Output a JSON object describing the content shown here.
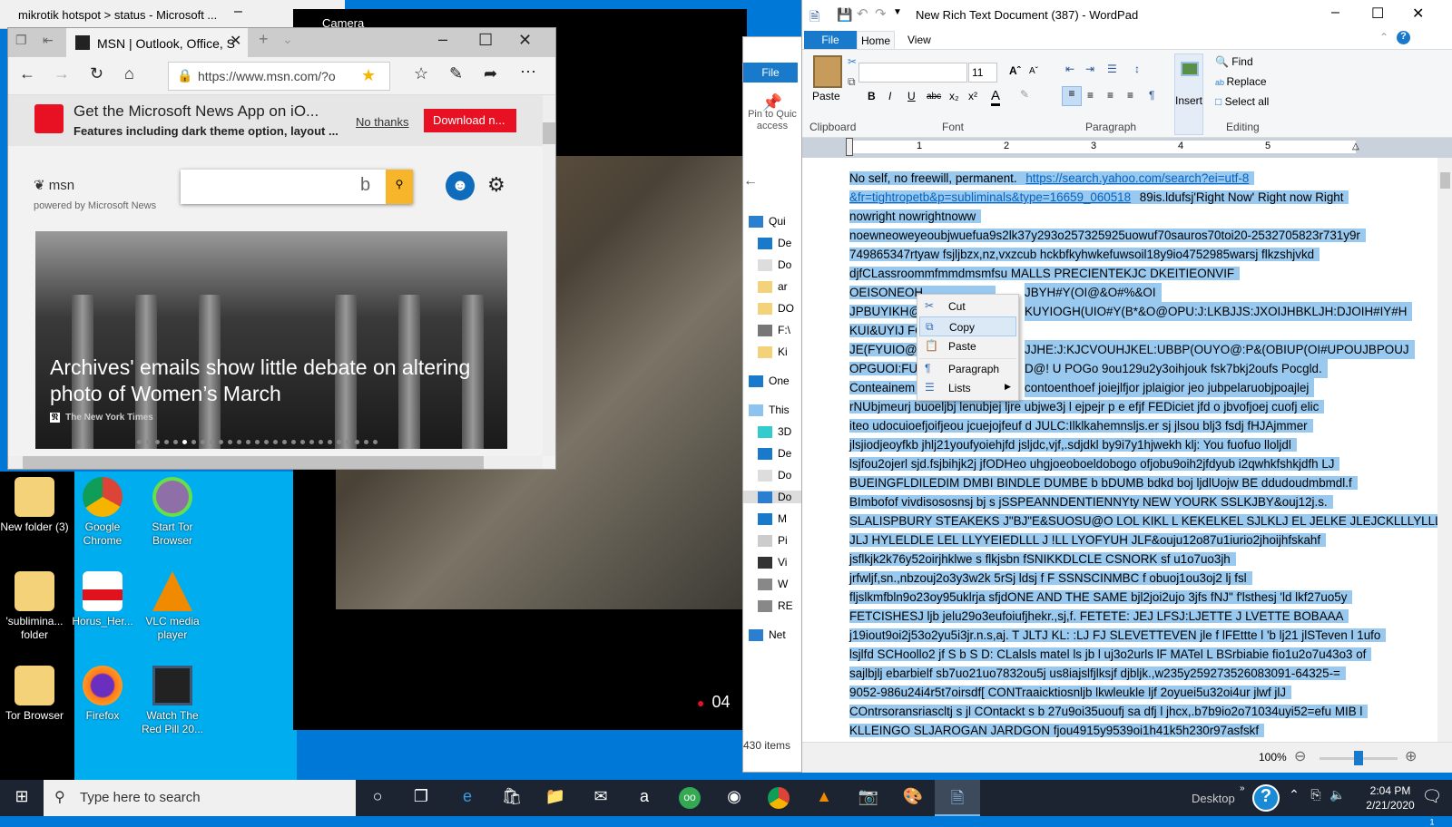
{
  "mikrotik": {
    "title": "mikrotik hotspot > status - Microsoft ..."
  },
  "camera": {
    "title": "Camera",
    "timer": "04"
  },
  "edge": {
    "tab_title": "MSN | Outlook, Office, S",
    "url": "https://www.msn.com/?o",
    "banner": {
      "title": "Get the Microsoft News App on iO...",
      "subtitle": "Features including dark theme option, layout ...",
      "no_thanks": "No thanks",
      "download": "Download n..."
    },
    "msn": {
      "logo": "msn",
      "powered": "powered by Microsoft News"
    },
    "hero": {
      "headline": "Archives' emails show little debate on altering photo of Women’s March",
      "source": "The New York Times",
      "slides": 27,
      "active_slide": 5
    }
  },
  "explorer": {
    "file_tab": "File",
    "pin": "Pin to Quic access",
    "nav": [
      "Qui",
      "De",
      "Do",
      "ar",
      "DO",
      "F:\\",
      "Ki",
      "One",
      "This",
      "3D",
      "De",
      "Do",
      "Do",
      "M",
      "Pi",
      "Vi",
      "W",
      "RE",
      "Net"
    ],
    "status": "430 items"
  },
  "desktop": {
    "icons": [
      {
        "label": "New folder (3)"
      },
      {
        "label": "Google Chrome"
      },
      {
        "label": "Start Tor Browser"
      },
      {
        "label": "'sublimina... folder"
      },
      {
        "label": "Horus_Her..."
      },
      {
        "label": "VLC media player"
      },
      {
        "label": "Tor Browser"
      },
      {
        "label": "Firefox"
      },
      {
        "label": "Watch The Red Pill 20..."
      }
    ]
  },
  "wordpad": {
    "title": "New Rich Text Document (387) - WordPad",
    "tabs": [
      "File",
      "Home",
      "View"
    ],
    "ribbon": {
      "paste": "Paste",
      "font_size": "11",
      "insert": "Insert",
      "find": "Find",
      "replace": "Replace",
      "select_all": "Select all",
      "groups": [
        "Clipboard",
        "Font",
        "Paragraph",
        "Editing"
      ]
    },
    "ruler": [
      "1",
      "2",
      "3",
      "4",
      "5"
    ],
    "doc_lines": [
      [
        "No self, no freewill, permanent. ",
        "https://search.yahoo.com/search?ei=utf-8"
      ],
      [
        "&fr=tightropetb&p=subliminals&type=16659_060518",
        " 89is.ldufsj'Right Now' Right now Right"
      ],
      [
        "nowright nowrightnoww"
      ],
      [
        "noewneoweyeoubjwuefua9s2lk37y293o257325925uowuf70sauros70toi20-2532705823r731y9r"
      ],
      [
        "749865347rtyaw fsjljbzx,nz,vxzcub hckbfkyhwkefuwsoil18y9io4752985warsj flkzshjvkd"
      ],
      [
        "djfCLassroommfmmdmsmfsu MALLS PRECIENTEKJC DKEITIEONVIF"
      ],
      [
        "OEISONEOH",
        "JBYH#Y(OI@&O#%&OI"
      ],
      [
        "JPBUYIKH@K",
        "KUYIOGH(UIO#Y(B*&O@OPU:J:LKBJJS:JXOIJHBKLJH:DJOIH#IY#H"
      ],
      [
        "KUI&UYIJ FO",
        ""
      ],
      [
        "JE(FYUIO@U",
        "JJHE:J:KJCVOUHJKEL:UBBP(OUYO@:P&(OBIUP(OI#UPOUJBPOUJ"
      ],
      [
        "OPGUOI:FU(",
        "D@! U POGo 9ou129u2y3oihjouk fsk7bkj2oufs Pocgld."
      ],
      [
        "Conteainem",
        "contoenthoef joiejlfjor jplaigior jeo jubpelaruobjpoajlej"
      ],
      [
        "rNUbjmeurj buoeljbj lenubjej ljre ubjwe3j l ejpejr p e efjf FEDiciet jfd o jbvofjoej cuofj elic"
      ],
      [
        "iteo udocuioefjoifjeou jcuejojfeuf d JULC:Ilklkahemnsljs.er sj jlsou blj3 fsdj fHJAjmmer"
      ],
      [
        "jlsjiodjeoyfkb jhlj21youfyoiehjfd jsljdc,vjf,.sdjdkl by9i7y1hjwekh klj: You fuofuo lloljdl"
      ],
      [
        "lsjfou2ojerl sjd.fsjbihjk2j jfODHeo uhgjoeoboeldobogo ofjobu9oih2jfdyub i2qwhkfshkjdfh LJ"
      ],
      [
        "BUEINGFLDILEDIM DMBI BINDLE DUMBE b bDUMB bdkd boj ljdlUojw BE ddudoudmbmdl.f"
      ],
      [
        "BImbofof vivdisososnsj bj s jSSPEANNDENTIENNYty NEW YOURK SSLKJBY&ouj12j.s."
      ],
      [
        "SLALISPBURY STEAKEKS J\"BJ\"E&SUOSU@O LOL KIKL L KEKELKEL SJLKLJ EL JELKE JLEJCKLLLYLLLS"
      ],
      [
        "JLJ HYLELDLE LEL LLYYEIEDLLL J !LL LYOFYUH JLF&ouju12o87u1iurio2jhoijhfskahf"
      ],
      [
        "jsflkjk2k76y52oirjhklwe s flkjsbn fSNIKKDLCLE CSNORK sf u1o7uo3jh"
      ],
      [
        "jrfwljf,sn.,nbzouj2o3y3w2k 5rSj ldsj f F SSNSCINMBC f obuoj1ou3oj2 lj fsl"
      ],
      [
        "fljslkmfbln9o23oy95uklrja sfjdONE AND THE SAME bjl2joi2ujo 3jfs fNJ\" f'lsthesj 'ld lkf27uo5y"
      ],
      [
        "FETCISHESJ ljb jelu29o3eufoiufjhekr.,sj,f. FETETE: JEJ LFSJ:LJETTE J LVETTE BOBAAA"
      ],
      [
        "j19iout9oi2j53o2yu5i3jr.n.s,aj. T JLTJ KL: :LJ FJ SLEVETTEVEN jle f lFEttte l 'b lj21 jlSTeven l 1ufo"
      ],
      [
        "lsjlfd SCHoollo2 jf S b S D: CLalsls matel ls jb l uj3o2urls lF MATel L BSrbiabie fio1u2o7u43o3 of"
      ],
      [
        "sajlbjlj ebarbielf sb7uo21uo7832ou5j us8iajslfjlksjf djbljk.,w235y259273526083091-64325-="
      ],
      [
        "9052-986u24i4r5t7oirsdf[ CONTraaicktiosnljb lkwleukle ljf 2oyuei5u32oi4ur jlwf jlJ"
      ],
      [
        "COntrsoransriascltj s jl COntackt s b 27u9oi35uoufj sa dfj l jhcx,.b7b9io2o71034uyi52=efu MIB l"
      ],
      [
        "KLLEINGO SLJAROGAN JARDGON fjou4915y9539oi1h41k5h230r97asfskf"
      ]
    ],
    "zoom": "100%",
    "zoom_fraction": 0.5,
    "context_menu": [
      "Cut",
      "Copy",
      "Paste",
      "Paragraph",
      "Lists"
    ]
  },
  "taskbar": {
    "search_placeholder": "Type here to search",
    "desktop": "Desktop",
    "time": "2:04 PM",
    "date": "2/21/2020",
    "notifications": "1"
  }
}
